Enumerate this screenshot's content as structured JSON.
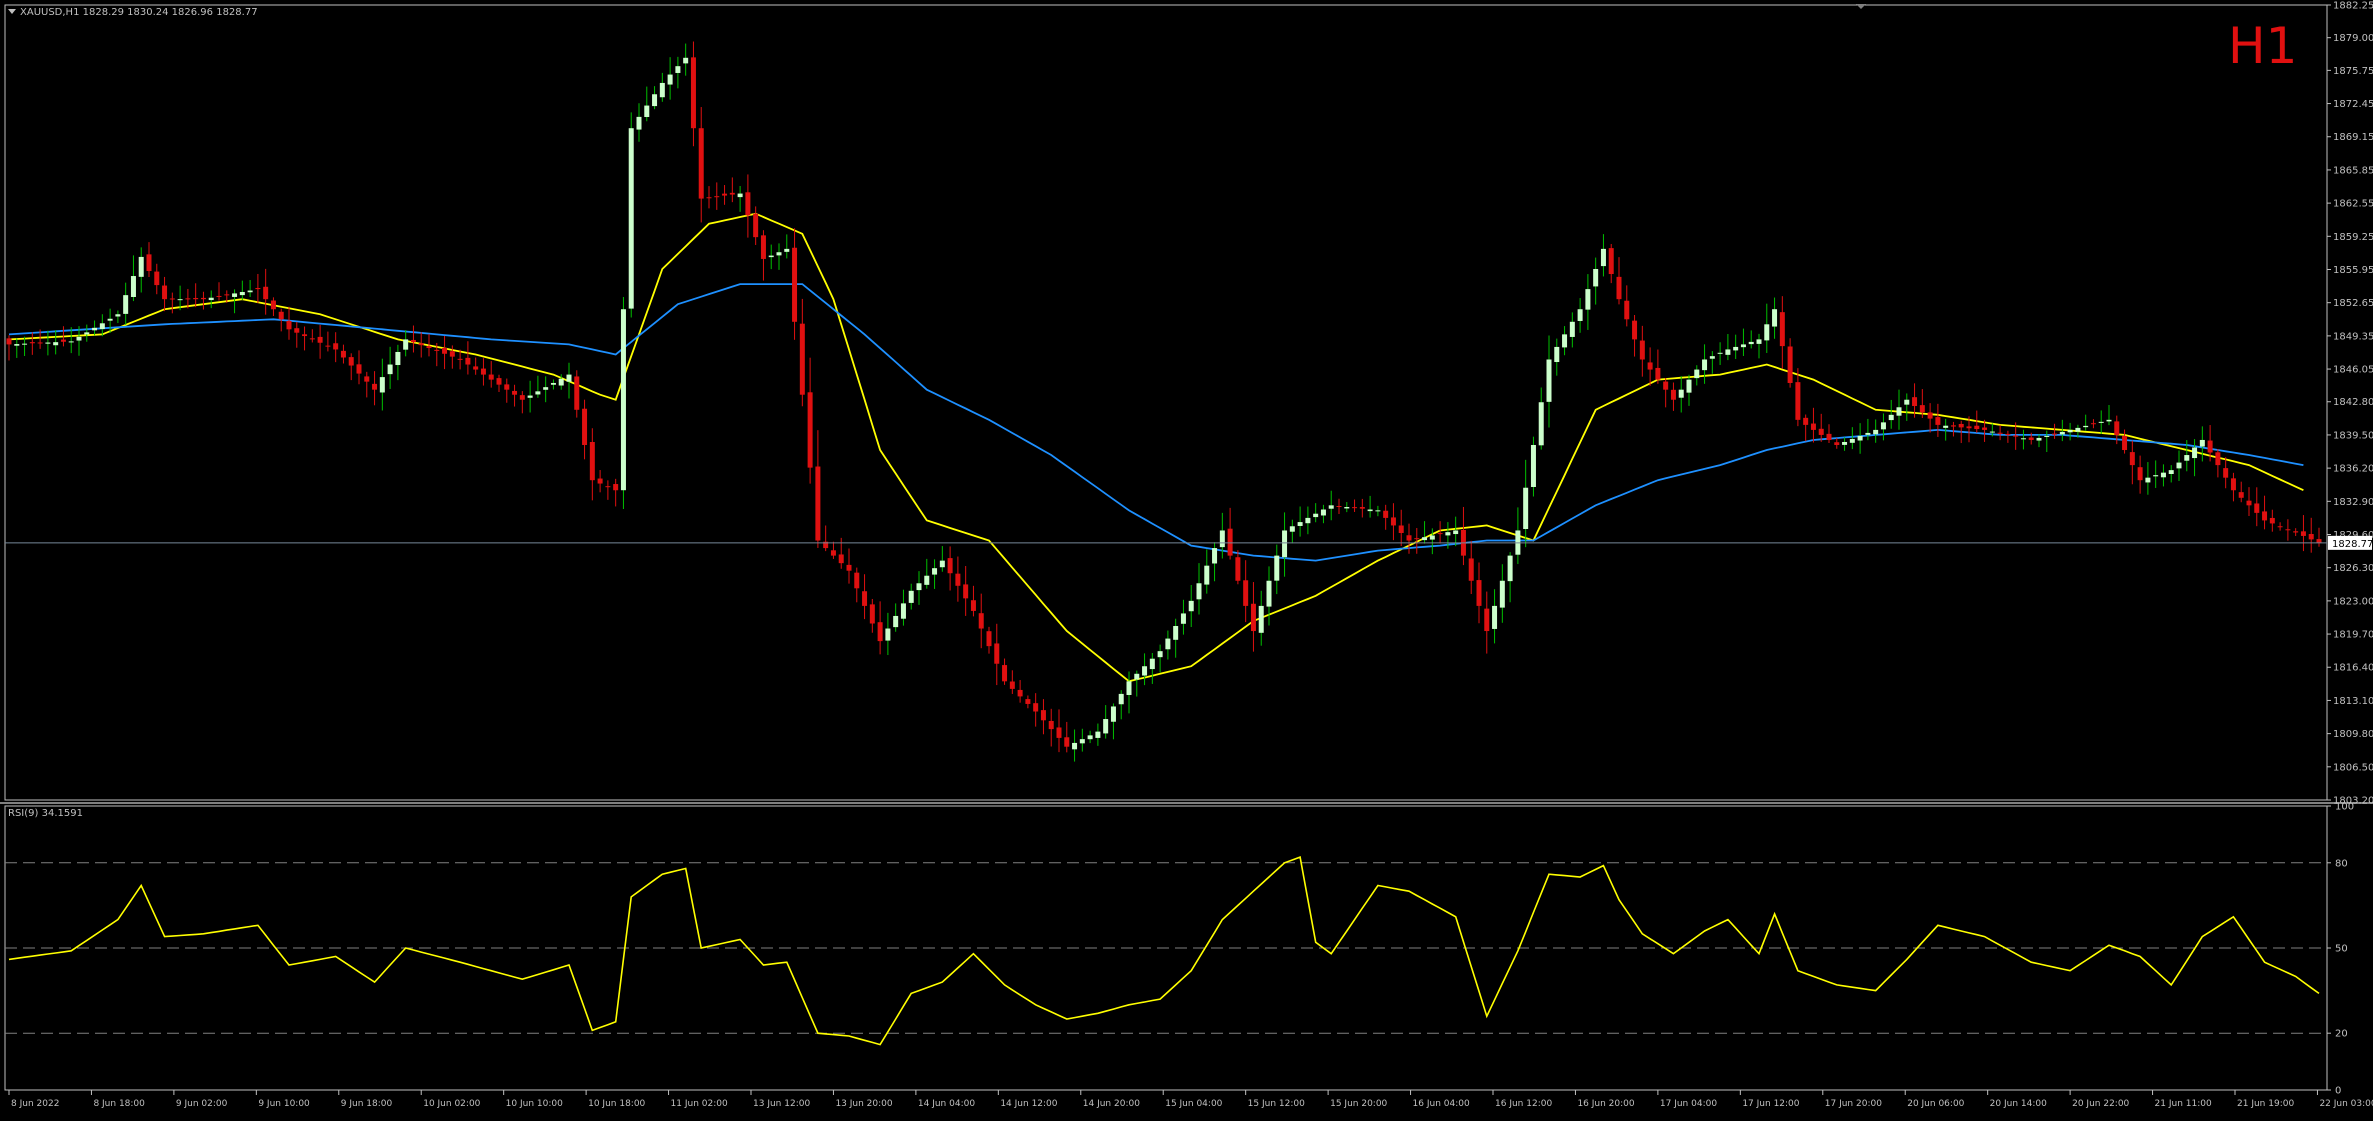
{
  "header": {
    "symbol_line": "XAUUSD,H1  1828.29 1830.24 1826.96 1828.77",
    "timeframe_badge": "H1",
    "indicator_label": "RSI(9) 34.1591"
  },
  "colors": {
    "background": "#000000",
    "frame": "#c0c0c0",
    "bull_candle": "#ccffcc",
    "bull_candle_wick": "#00c000",
    "bear_candle": "#e01010",
    "ma_fast": "#ffff00",
    "ma_slow": "#1e90ff",
    "rsi_line": "#ffff00",
    "price_line": "#778899",
    "timeframe_badge": "#e01010",
    "text": "#c0c0c0"
  },
  "price_axis": {
    "labels": [
      "1882.25",
      "1879.00",
      "1875.75",
      "1872.45",
      "1869.15",
      "1865.85",
      "1862.55",
      "1859.25",
      "1855.95",
      "1852.65",
      "1849.35",
      "1846.05",
      "1842.80",
      "1839.50",
      "1836.20",
      "1832.90",
      "1829.60",
      "1826.30",
      "1823.00",
      "1819.70",
      "1816.40",
      "1813.10",
      "1809.80",
      "1806.50",
      "1803.20"
    ],
    "current_price_label": "1828.77"
  },
  "rsi_axis": {
    "labels": [
      "100",
      "80",
      "50",
      "20",
      "0"
    ]
  },
  "time_axis": {
    "labels": [
      "8 Jun 2022",
      "8 Jun 18:00",
      "9 Jun 02:00",
      "9 Jun 10:00",
      "9 Jun 18:00",
      "10 Jun 02:00",
      "10 Jun 10:00",
      "10 Jun 18:00",
      "11 Jun 02:00",
      "13 Jun 12:00",
      "13 Jun 20:00",
      "14 Jun 04:00",
      "14 Jun 12:00",
      "14 Jun 20:00",
      "15 Jun 04:00",
      "15 Jun 12:00",
      "15 Jun 20:00",
      "16 Jun 04:00",
      "16 Jun 12:00",
      "16 Jun 20:00",
      "17 Jun 04:00",
      "17 Jun 12:00",
      "17 Jun 20:00",
      "20 Jun 06:00",
      "20 Jun 14:00",
      "20 Jun 22:00",
      "21 Jun 11:00",
      "21 Jun 19:00",
      "22 Jun 03:00"
    ]
  },
  "chart_data": [
    {
      "type": "candlestick",
      "symbol": "XAUUSD",
      "timeframe": "H1",
      "last_bar": {
        "open": 1828.29,
        "high": 1830.24,
        "low": 1826.96,
        "close": 1828.77
      },
      "ylim": [
        1803.2,
        1882.25
      ],
      "grid": false,
      "anchors": [
        [
          0,
          1848.5
        ],
        [
          8,
          1848.8
        ],
        [
          14,
          1851.5
        ],
        [
          17,
          1857.2
        ],
        [
          20,
          1853.0
        ],
        [
          25,
          1853.0
        ],
        [
          32,
          1854.0
        ],
        [
          36,
          1850.0
        ],
        [
          42,
          1848.0
        ],
        [
          47,
          1844.0
        ],
        [
          51,
          1849.0
        ],
        [
          58,
          1847.0
        ],
        [
          66,
          1843.0
        ],
        [
          72,
          1845.5
        ],
        [
          75,
          1835.0
        ],
        [
          78,
          1834.0
        ],
        [
          80,
          1870.0
        ],
        [
          84,
          1874.5
        ],
        [
          87,
          1877.0
        ],
        [
          89,
          1863.0
        ],
        [
          94,
          1863.5
        ],
        [
          97,
          1857.0
        ],
        [
          100,
          1858.0
        ],
        [
          104,
          1829.0
        ],
        [
          108,
          1826.0
        ],
        [
          112,
          1819.0
        ],
        [
          116,
          1824.0
        ],
        [
          120,
          1827.0
        ],
        [
          124,
          1822.0
        ],
        [
          128,
          1815.0
        ],
        [
          132,
          1812.0
        ],
        [
          136,
          1808.5
        ],
        [
          140,
          1810.0
        ],
        [
          144,
          1815.0
        ],
        [
          148,
          1818.0
        ],
        [
          152,
          1823.0
        ],
        [
          156,
          1830.0
        ],
        [
          160,
          1820.0
        ],
        [
          164,
          1830.0
        ],
        [
          170,
          1832.5
        ],
        [
          176,
          1832.0
        ],
        [
          180,
          1829.0
        ],
        [
          186,
          1830.0
        ],
        [
          190,
          1820.0
        ],
        [
          194,
          1830.0
        ],
        [
          198,
          1847.0
        ],
        [
          202,
          1852.0
        ],
        [
          205,
          1858.0
        ],
        [
          207,
          1853.0
        ],
        [
          210,
          1847.0
        ],
        [
          214,
          1843.0
        ],
        [
          218,
          1847.0
        ],
        [
          221,
          1848.0
        ],
        [
          225,
          1849.0
        ],
        [
          227,
          1852.0
        ],
        [
          230,
          1841.0
        ],
        [
          235,
          1838.5
        ],
        [
          240,
          1840.0
        ],
        [
          244,
          1843.0
        ],
        [
          248,
          1840.5
        ],
        [
          254,
          1840.0
        ],
        [
          260,
          1839.0
        ],
        [
          265,
          1840.0
        ],
        [
          270,
          1841.0
        ],
        [
          274,
          1835.0
        ],
        [
          278,
          1836.0
        ],
        [
          282,
          1839.0
        ],
        [
          286,
          1834.0
        ],
        [
          290,
          1831.0
        ],
        [
          294,
          1829.8
        ],
        [
          297,
          1828.77
        ]
      ],
      "moving_averages": [
        {
          "name": "MA fast",
          "color": "#ffff00",
          "anchors": [
            [
              0,
              1849.0
            ],
            [
              12,
              1849.5
            ],
            [
              20,
              1852.0
            ],
            [
              30,
              1853.0
            ],
            [
              40,
              1851.5
            ],
            [
              50,
              1849.0
            ],
            [
              60,
              1847.5
            ],
            [
              70,
              1845.5
            ],
            [
              76,
              1843.5
            ],
            [
              78,
              1843.0
            ],
            [
              84,
              1856.0
            ],
            [
              90,
              1860.5
            ],
            [
              96,
              1861.5
            ],
            [
              102,
              1859.5
            ],
            [
              106,
              1853.0
            ],
            [
              112,
              1838.0
            ],
            [
              118,
              1831.0
            ],
            [
              126,
              1829.0
            ],
            [
              136,
              1820.0
            ],
            [
              144,
              1815.0
            ],
            [
              152,
              1816.5
            ],
            [
              160,
              1821.0
            ],
            [
              168,
              1823.5
            ],
            [
              176,
              1827.0
            ],
            [
              184,
              1830.0
            ],
            [
              190,
              1830.5
            ],
            [
              196,
              1829.0
            ],
            [
              204,
              1842.0
            ],
            [
              212,
              1845.0
            ],
            [
              220,
              1845.5
            ],
            [
              226,
              1846.5
            ],
            [
              232,
              1845.0
            ],
            [
              240,
              1842.0
            ],
            [
              248,
              1841.5
            ],
            [
              256,
              1840.5
            ],
            [
              264,
              1840.0
            ],
            [
              272,
              1839.5
            ],
            [
              280,
              1838.0
            ],
            [
              288,
              1836.5
            ],
            [
              295,
              1834.0
            ]
          ]
        },
        {
          "name": "MA slow",
          "color": "#1e90ff",
          "anchors": [
            [
              0,
              1849.5
            ],
            [
              20,
              1850.5
            ],
            [
              34,
              1851.0
            ],
            [
              48,
              1850.0
            ],
            [
              62,
              1849.0
            ],
            [
              72,
              1848.5
            ],
            [
              78,
              1847.5
            ],
            [
              86,
              1852.5
            ],
            [
              94,
              1854.5
            ],
            [
              102,
              1854.5
            ],
            [
              110,
              1849.5
            ],
            [
              118,
              1844.0
            ],
            [
              126,
              1841.0
            ],
            [
              134,
              1837.5
            ],
            [
              144,
              1832.0
            ],
            [
              152,
              1828.5
            ],
            [
              160,
              1827.5
            ],
            [
              168,
              1827.0
            ],
            [
              176,
              1828.0
            ],
            [
              184,
              1828.5
            ],
            [
              190,
              1829.0
            ],
            [
              196,
              1829.0
            ],
            [
              204,
              1832.5
            ],
            [
              212,
              1835.0
            ],
            [
              220,
              1836.5
            ],
            [
              226,
              1838.0
            ],
            [
              232,
              1839.0
            ],
            [
              240,
              1839.5
            ],
            [
              248,
              1840.0
            ],
            [
              256,
              1839.5
            ],
            [
              264,
              1839.5
            ],
            [
              272,
              1839.0
            ],
            [
              280,
              1838.5
            ],
            [
              288,
              1837.5
            ],
            [
              295,
              1836.5
            ]
          ]
        }
      ],
      "current_price": 1828.77
    },
    {
      "type": "line",
      "name": "RSI(9)",
      "last_value": 34.1591,
      "ylim": [
        0,
        100
      ],
      "levels": [
        80,
        50,
        20
      ],
      "anchors": [
        [
          0,
          46
        ],
        [
          8,
          49
        ],
        [
          14,
          60
        ],
        [
          17,
          72
        ],
        [
          20,
          54
        ],
        [
          25,
          55
        ],
        [
          32,
          58
        ],
        [
          36,
          44
        ],
        [
          42,
          47
        ],
        [
          47,
          38
        ],
        [
          51,
          50
        ],
        [
          58,
          45
        ],
        [
          66,
          39
        ],
        [
          72,
          44
        ],
        [
          75,
          21
        ],
        [
          78,
          24
        ],
        [
          80,
          68
        ],
        [
          84,
          76
        ],
        [
          87,
          78
        ],
        [
          89,
          50
        ],
        [
          94,
          53
        ],
        [
          97,
          44
        ],
        [
          100,
          45
        ],
        [
          104,
          20
        ],
        [
          108,
          19
        ],
        [
          112,
          16
        ],
        [
          116,
          34
        ],
        [
          120,
          38
        ],
        [
          124,
          48
        ],
        [
          128,
          37
        ],
        [
          132,
          30
        ],
        [
          136,
          25
        ],
        [
          140,
          27
        ],
        [
          144,
          30
        ],
        [
          148,
          32
        ],
        [
          152,
          42
        ],
        [
          156,
          60
        ],
        [
          160,
          70
        ],
        [
          164,
          80
        ],
        [
          166,
          82
        ],
        [
          168,
          52
        ],
        [
          170,
          48
        ],
        [
          176,
          72
        ],
        [
          180,
          70
        ],
        [
          186,
          61
        ],
        [
          190,
          26
        ],
        [
          194,
          49
        ],
        [
          198,
          76
        ],
        [
          202,
          75
        ],
        [
          205,
          79
        ],
        [
          207,
          67
        ],
        [
          210,
          55
        ],
        [
          214,
          48
        ],
        [
          218,
          56
        ],
        [
          221,
          60
        ],
        [
          225,
          48
        ],
        [
          227,
          62
        ],
        [
          230,
          42
        ],
        [
          235,
          37
        ],
        [
          240,
          35
        ],
        [
          244,
          46
        ],
        [
          248,
          58
        ],
        [
          254,
          54
        ],
        [
          260,
          45
        ],
        [
          265,
          42
        ],
        [
          270,
          51
        ],
        [
          274,
          47
        ],
        [
          278,
          37
        ],
        [
          282,
          54
        ],
        [
          286,
          61
        ],
        [
          290,
          45
        ],
        [
          294,
          40
        ],
        [
          297,
          34
        ]
      ]
    }
  ]
}
